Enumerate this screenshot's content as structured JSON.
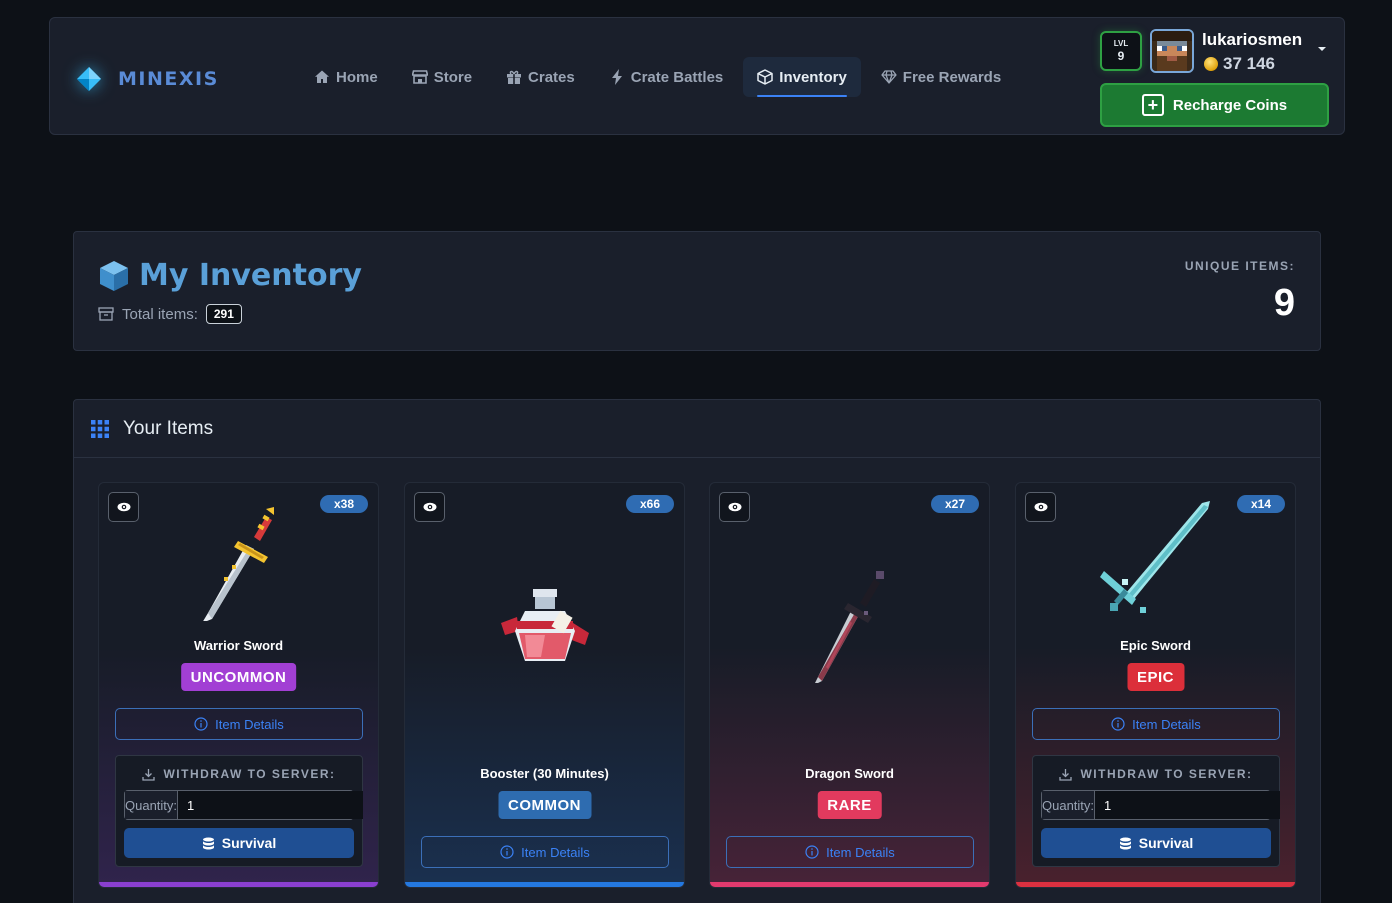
{
  "brand": {
    "name": "MINEXIS"
  },
  "nav": {
    "items": [
      {
        "label": "Home",
        "icon": "home-icon",
        "active": false
      },
      {
        "label": "Store",
        "icon": "store-icon",
        "active": false
      },
      {
        "label": "Crates",
        "icon": "gift-icon",
        "active": false
      },
      {
        "label": "Crate Battles",
        "icon": "lightning-icon",
        "active": false
      },
      {
        "label": "Inventory",
        "icon": "box-icon",
        "active": true
      },
      {
        "label": "Free Rewards",
        "icon": "gem-icon",
        "active": false
      }
    ]
  },
  "user": {
    "level_label": "LVL",
    "level": "9",
    "username": "lukariosmen",
    "coins": "37 146",
    "recharge_label": "Recharge Coins"
  },
  "header": {
    "title": "My Inventory",
    "total_label": "Total items:",
    "total_value": "291",
    "unique_label": "UNIQUE ITEMS:",
    "unique_value": "9"
  },
  "items_section": {
    "title": "Your Items"
  },
  "items": [
    {
      "name": "Warrior Sword",
      "quantity": "x38",
      "rarity": "UNCOMMON",
      "rarity_color": "#a23fd4",
      "accent": "#8a3fd0",
      "details_label": "Item Details",
      "withdraw_label": "WITHDRAW TO SERVER:",
      "qty_label": "Quantity:",
      "qty_value": "1",
      "server_label": "Survival"
    },
    {
      "name": "Booster (30 Minutes)",
      "quantity": "x66",
      "rarity": "COMMON",
      "rarity_color": "#2e6cb0",
      "accent": "#2478e0",
      "details_label": "Item Details"
    },
    {
      "name": "Dragon Sword",
      "quantity": "x27",
      "rarity": "RARE",
      "rarity_color": "#e23a5e",
      "accent": "#e23a6e",
      "details_label": "Item Details"
    },
    {
      "name": "Epic Sword",
      "quantity": "x14",
      "rarity": "EPIC",
      "rarity_color": "#dc2f3a",
      "accent": "#dc3040",
      "details_label": "Item Details",
      "withdraw_label": "WITHDRAW TO SERVER:",
      "qty_label": "Quantity:",
      "qty_value": "1",
      "server_label": "Survival"
    }
  ]
}
